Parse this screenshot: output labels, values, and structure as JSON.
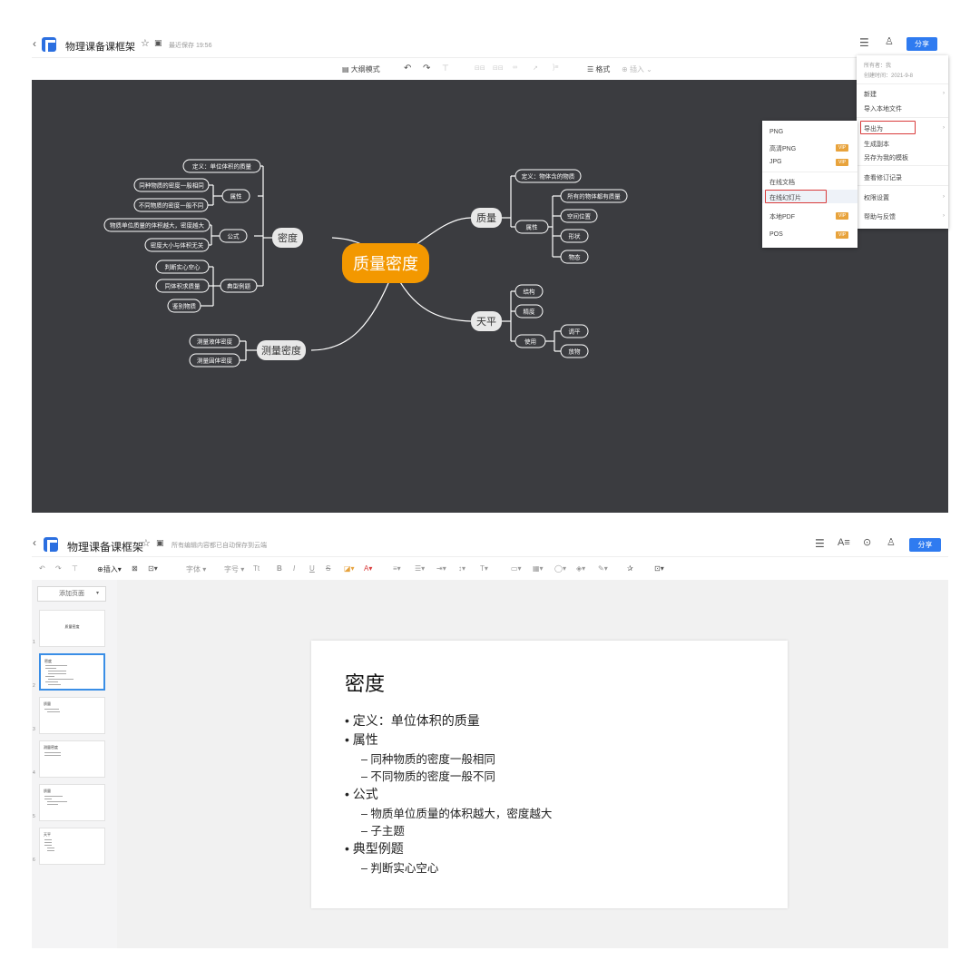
{
  "mindmap_app": {
    "title": "物理课备课框架",
    "save_status": "最近保存 19:56",
    "share_label": "分享",
    "toolbar": {
      "outline_mode": "大纲模式",
      "format": "格式",
      "insert": "插入"
    },
    "root": "质量密度",
    "branches": {
      "density": "密度",
      "mass": "质量",
      "balance": "天平",
      "measure": "测量密度"
    },
    "density_nodes": {
      "definition": "定义：单位体积的质量",
      "property": "属性",
      "property_1": "同种物质的密度一般相同",
      "property_2": "不同物质的密度一般不同",
      "formula": "公式",
      "formula_1": "物质单位质量的体积越大，密度越大",
      "formula_2": "密度大小与体积无关",
      "examples": "典型例题",
      "example_1": "判断实心空心",
      "example_2": "同体积求质量",
      "example_3": "鉴别物质"
    },
    "mass_nodes": {
      "definition": "定义：物体含的物质",
      "property": "属性",
      "property_1": "所有的物体都有质量",
      "property_2": "空间位置",
      "property_3": "形状",
      "property_4": "物态"
    },
    "balance_nodes": {
      "structure": "结构",
      "precision": "精度",
      "usage": "使用",
      "usage_1": "调平",
      "usage_2": "放物"
    },
    "measure_nodes": {
      "solid": "测量液体密度",
      "liquid": "测量固体密度"
    },
    "menu": {
      "owner": "所有者：我",
      "created": "创建时间：2021-9-8",
      "new": "新建",
      "import": "导入本地文件",
      "export_as": "导出为",
      "make_copy": "生成副本",
      "save_template": "另存为我的模板",
      "history": "查看修订记录",
      "permissions": "权限设置",
      "help": "帮助与反馈"
    },
    "export_submenu": {
      "png": "PNG",
      "png_hd": "高清PNG",
      "jpg": "JPG",
      "online_doc": "在线文档",
      "online_slides": "在线幻灯片",
      "local_pdf": "本地PDF",
      "pos": "POS",
      "vip_badge": "VIP"
    }
  },
  "slides_app": {
    "title": "物理课备课框架",
    "save_status": "所有编辑内容都已自动保存到云端",
    "share_label": "分享",
    "toolbar": {
      "insert": "插入",
      "font_name": "字体",
      "font_size": "字号",
      "tt": "Tt",
      "bold": "B",
      "italic": "I",
      "underline": "U",
      "strike": "S"
    },
    "add_page": "添加页面",
    "thumbnails": [
      {
        "num": "1",
        "title": "质量密度"
      },
      {
        "num": "2",
        "title": "密度"
      },
      {
        "num": "3",
        "title": "质量"
      },
      {
        "num": "4",
        "title": "测量密度"
      },
      {
        "num": "5",
        "title": "质量"
      },
      {
        "num": "6",
        "title": "天平"
      }
    ],
    "slide": {
      "title": "密度",
      "bullet_1": "•  定义：单位体积的质量",
      "bullet_2": "•  属性",
      "sub_2a": "–  同种物质的密度一般相同",
      "sub_2b": "–  不同物质的密度一般不同",
      "bullet_3": "•  公式",
      "sub_3a": "–  物质单位质量的体积越大，密度越大",
      "sub_3b": "–  子主题",
      "bullet_4": "•  典型例题",
      "sub_4a": "–  判断实心空心"
    }
  },
  "colors": {
    "accent_blue": "#2f7bf0",
    "root_orange": "#f39800",
    "canvas_dark": "#3b3c40",
    "highlight_red": "#d93b3b",
    "vip_gold": "#e8a33c"
  }
}
